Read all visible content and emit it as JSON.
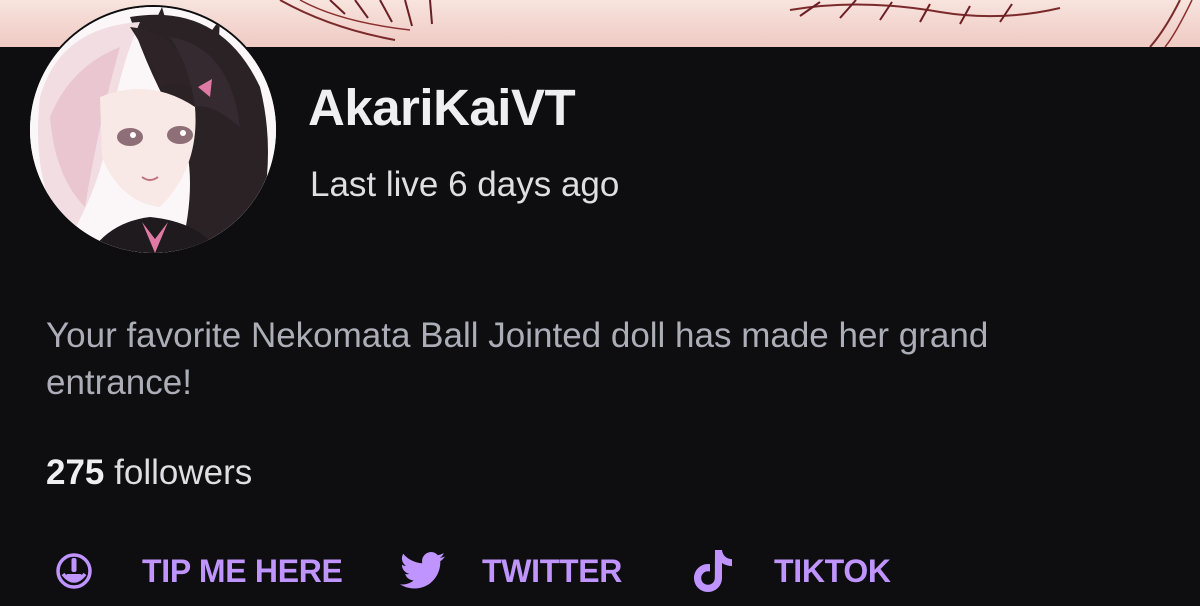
{
  "theme": {
    "background": "#0e0e10",
    "accent": "#bf94ff",
    "text_primary": "#efeff1",
    "text_secondary": "#adadb8"
  },
  "channel": {
    "name": "AkariKaiVT",
    "last_live": "Last live 6 days ago",
    "bio": "Your favorite Nekomata Ball Jointed doll has made her grand entrance!",
    "followers_count": "275",
    "followers_label": "followers"
  },
  "links": [
    {
      "label": "TIP ME HERE",
      "icon": "tip-icon"
    },
    {
      "label": "TWITTER",
      "icon": "twitter-icon"
    },
    {
      "label": "TIKTOK",
      "icon": "tiktok-icon"
    }
  ]
}
